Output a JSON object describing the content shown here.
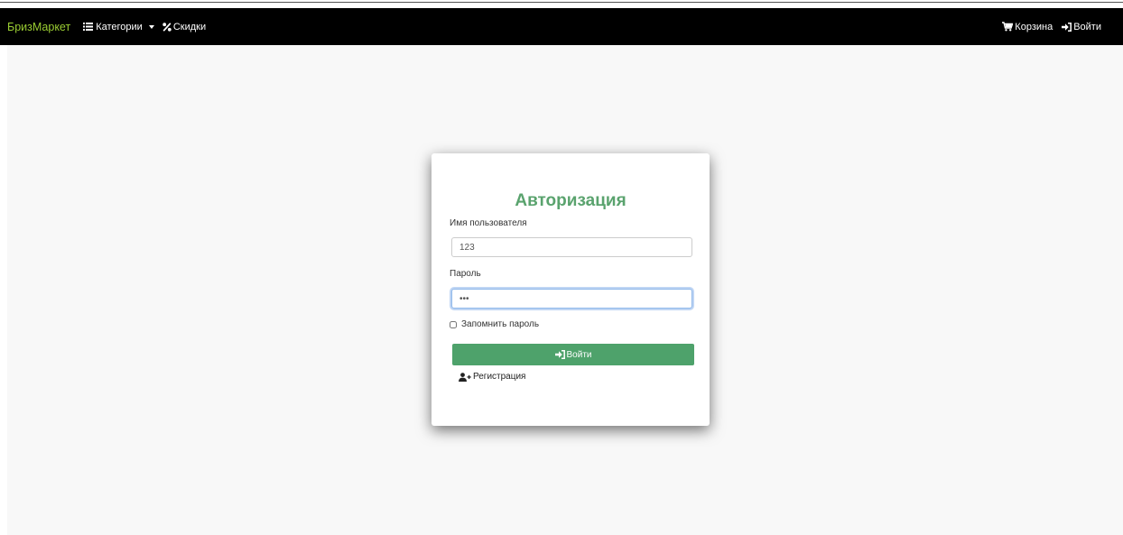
{
  "navbar": {
    "brand": "БризМаркет",
    "categories_label": "Категории",
    "discounts_label": "Скидки",
    "cart_label": "Корзина",
    "login_label": "Войти"
  },
  "login_form": {
    "title": "Авторизация",
    "username_label": "Имя пользователя",
    "username_value": "123",
    "password_label": "Пароль",
    "password_value": "123",
    "remember_label": "Запомнить пароль",
    "remember_checked": false,
    "submit_label": "Войти",
    "register_label": "Регистрация"
  },
  "colors": {
    "brand": "#9acd32",
    "title": "#5aa36e",
    "button": "#4ea26b"
  },
  "icons": {
    "categories": "list-icon",
    "discounts": "percent-icon",
    "cart": "cart-icon",
    "login": "sign-in-icon",
    "register": "user-plus-icon"
  }
}
